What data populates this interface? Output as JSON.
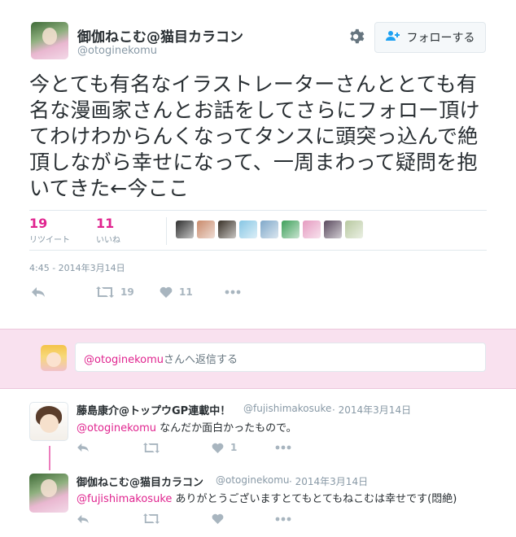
{
  "tweet": {
    "display_name": "御伽ねこむ@猫目カラコン",
    "handle": "@otoginekomu",
    "follow_label": "フォローする",
    "text": "今とても有名なイラストレーターさんととても有名な漫画家さんとお話をしてさらにフォロー頂けてわけわからんくなってタンスに頭突っ込んで絶頂しながら幸せになって、一周まわって疑問を抱いてきた←今ここ",
    "retweets_count": "19",
    "retweets_label": "リツイート",
    "likes_count": "11",
    "likes_label": "いいね",
    "timestamp": "4:45 - 2014年3月14日",
    "action_retweet_count": "19",
    "action_like_count": "11",
    "liker_colors": [
      "#2f2f2f",
      "#c98a6b",
      "#3a3228",
      "#86c6e4",
      "#7fa8c9",
      "#3ea05a",
      "#e59ac0",
      "#5a4a5e",
      "#b8c9a0"
    ]
  },
  "reply_box": {
    "mention": "@otoginekomu",
    "suffix": "さんへ返信する"
  },
  "replies": [
    {
      "display_name": "藤島康介@トップウGP連載中！",
      "handle": "@fujishimakosuke",
      "date": "· 2014年3月14日",
      "mention": "@otoginekomu",
      "text": " なんだか面白かったもので。",
      "like_count": "1"
    },
    {
      "display_name": "御伽ねこむ@猫目カラコン",
      "handle": "@otoginekomu",
      "date": "· 2014年3月14日",
      "mention": "@fujishimakosuke",
      "text": " ありがとうございますとてもとてもねこむは幸せです(悶絶)",
      "like_count": ""
    }
  ],
  "colors": {
    "accent": "#e0248f",
    "reply_band": "#f9e1ef",
    "muted": "#8899a6"
  }
}
